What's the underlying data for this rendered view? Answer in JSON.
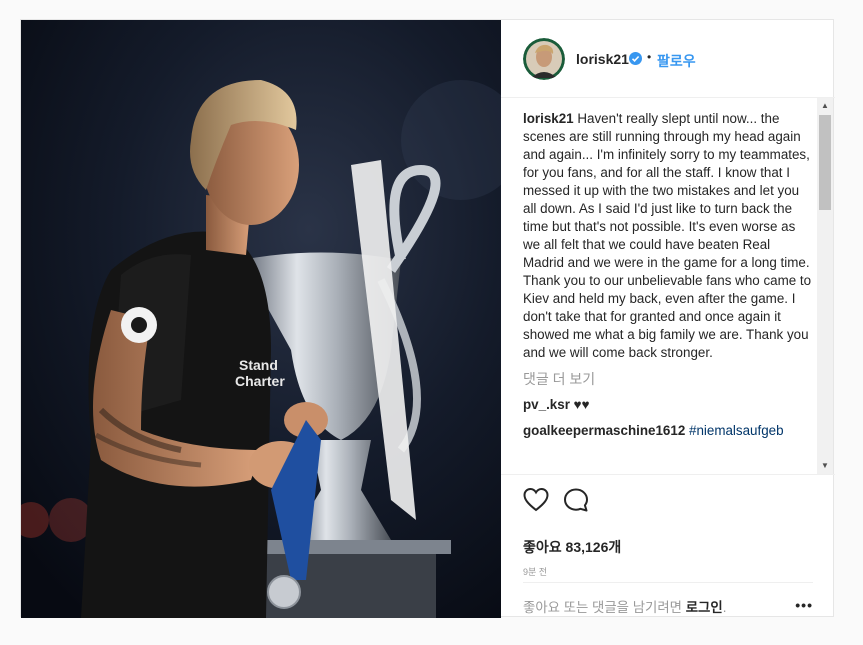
{
  "post": {
    "author": {
      "username": "lorisk21",
      "verified_icon": "verified-badge-icon",
      "follow_label": "팔로우",
      "separator": "•"
    },
    "caption": {
      "username": "lorisk21",
      "text": "Haven't really slept until now... the scenes are still running through my head again and again... I'm infinitely sorry to my teammates, for you fans, and for all the staff. I know that I messed it up with the two mistakes and let you all down. As I said I'd just like to turn back the time but that's not possible. It's even worse as we all felt that we could have beaten Real Madrid and we were in the game for a long time. Thank you to our unbelievable fans who came to Kiev and held my back, even after the game. I don't take that for granted and once again it showed me what a big family we are. Thank you and we will come back stronger."
    },
    "view_more_comments": "댓글 더 보기",
    "comments": [
      {
        "username": "pv_.ksr",
        "text": "♥♥"
      },
      {
        "username": "goalkeepermaschine1612",
        "text": "#niemalsaufgeb"
      }
    ],
    "likes_label": "좋아요 83,126개",
    "time_ago": "9분 전",
    "login_prompt": {
      "prefix": "좋아요 또는 댓글을 남기려면 ",
      "link": "로그인",
      "suffix": "."
    },
    "more_options": "•••"
  },
  "colors": {
    "link_blue": "#3897f0",
    "muted": "#999999",
    "text": "#262626"
  }
}
